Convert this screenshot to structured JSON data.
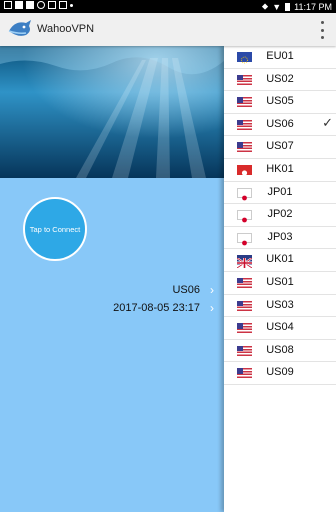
{
  "status_bar": {
    "time": "11:17 PM"
  },
  "app": {
    "title": "WahooVPN"
  },
  "main": {
    "connect_label": "Tap to Connect",
    "selected_server": "US06",
    "expiry": "2017-08-05 23:17"
  },
  "servers": [
    {
      "name": "EU01",
      "flag": "eu-flag",
      "selected": false
    },
    {
      "name": "US02",
      "flag": "us-flag",
      "selected": false
    },
    {
      "name": "US05",
      "flag": "us-flag",
      "selected": false
    },
    {
      "name": "US06",
      "flag": "us-flag",
      "selected": true
    },
    {
      "name": "US07",
      "flag": "us-flag",
      "selected": false
    },
    {
      "name": "HK01",
      "flag": "hk-flag",
      "selected": false
    },
    {
      "name": "JP01",
      "flag": "jp-flag",
      "selected": false
    },
    {
      "name": "JP02",
      "flag": "jp-flag",
      "selected": false
    },
    {
      "name": "JP03",
      "flag": "jp-flag",
      "selected": false
    },
    {
      "name": "UK01",
      "flag": "uk-flag",
      "selected": false
    },
    {
      "name": "US01",
      "flag": "us-flag",
      "selected": false
    },
    {
      "name": "US03",
      "flag": "us-flag",
      "selected": false
    },
    {
      "name": "US04",
      "flag": "us-flag",
      "selected": false
    },
    {
      "name": "US08",
      "flag": "us-flag",
      "selected": false
    },
    {
      "name": "US09",
      "flag": "us-flag",
      "selected": false
    }
  ],
  "colors": {
    "background": "#88c8f8",
    "connect_button": "#2ea8e6",
    "app_bar": "#f0f0f0"
  }
}
